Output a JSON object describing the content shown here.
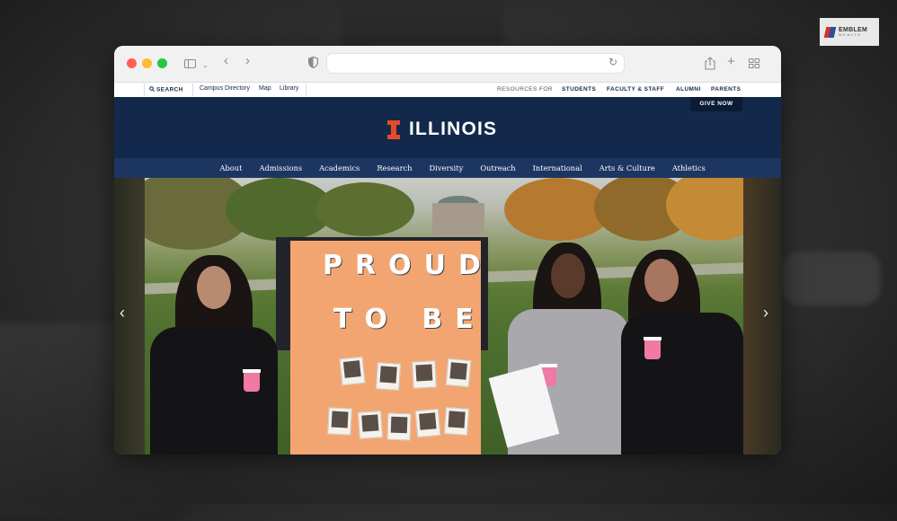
{
  "watermark": {
    "line1": "EMBLEM",
    "line2": "WEALTH"
  },
  "utility_bar": {
    "search_label": "SEARCH",
    "links": [
      "Campus Directory",
      "Map",
      "Library"
    ],
    "resources_label": "RESOURCES FOR",
    "audiences": [
      "STUDENTS",
      "FACULTY & STAFF",
      "ALUMNI",
      "PARENTS"
    ]
  },
  "header": {
    "give_now": "GIVE NOW",
    "brand": "ILLINOIS"
  },
  "nav": {
    "items": [
      "About",
      "Admissions",
      "Academics",
      "Research",
      "Diversity",
      "Outreach",
      "International",
      "Arts & Culture",
      "Athletics"
    ]
  },
  "hero": {
    "sign_line1": "PROUD",
    "sign_line2": "TO BE"
  },
  "colors": {
    "brand_blue": "#13294b",
    "brand_orange": "#e84a27"
  }
}
